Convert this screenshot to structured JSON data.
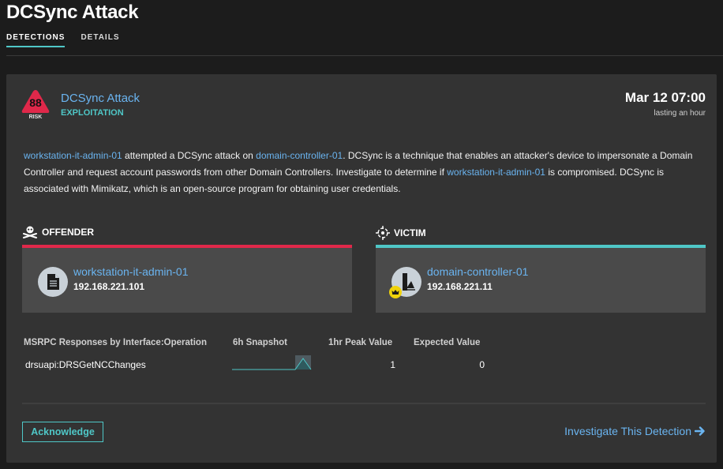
{
  "page": {
    "title": "DCSync Attack",
    "tabs": [
      {
        "label": "DETECTIONS",
        "active": true
      },
      {
        "label": "DETAILS",
        "active": false
      }
    ]
  },
  "detection": {
    "risk_score": "88",
    "risk_label": "RISK",
    "title": "DCSync Attack",
    "category": "EXPLOITATION",
    "time": "Mar 12 07:00",
    "duration": "lasting an hour",
    "description": {
      "offender_link": "workstation-it-admin-01",
      "part1": " attempted a DCSync attack on ",
      "victim_link": "domain-controller-01",
      "part2": ". DCSync is a technique that enables an attacker's device to impersonate a Domain Controller and request account passwords from other Domain Controllers. Investigate to determine if ",
      "offender_link_2": "workstation-it-admin-01",
      "part3": " is compromised. DCSync is associated with Mimikatz, which is an open-source program for obtaining user credentials."
    },
    "offender": {
      "heading": "OFFENDER",
      "icon": "skull-crossbones-icon",
      "device_icon": "document-icon",
      "name": "workstation-it-admin-01",
      "ip": "192.168.221.101"
    },
    "victim": {
      "heading": "VICTIM",
      "icon": "crosshair-icon",
      "device_icon": "domain-controller-icon",
      "badge_icon": "crown-icon",
      "name": "domain-controller-01",
      "ip": "192.168.221.11"
    },
    "metrics": {
      "headers": [
        "MSRPC Responses by Interface:Operation",
        "6h Snapshot",
        "1hr Peak Value",
        "Expected Value"
      ],
      "rows": [
        {
          "operation": "drsuapi:DRSGetNCChanges",
          "peak": "1",
          "expected": "0",
          "snapshot": [
            0,
            0,
            0,
            0,
            0,
            0,
            0,
            0,
            0,
            1,
            0
          ]
        }
      ]
    },
    "actions": {
      "acknowledge": "Acknowledge",
      "investigate": "Investigate This Detection"
    },
    "colors": {
      "accent": "#4fc7c7",
      "link": "#6ab4f0",
      "risk": "#e0284a",
      "crown": "#f0d20a"
    }
  }
}
